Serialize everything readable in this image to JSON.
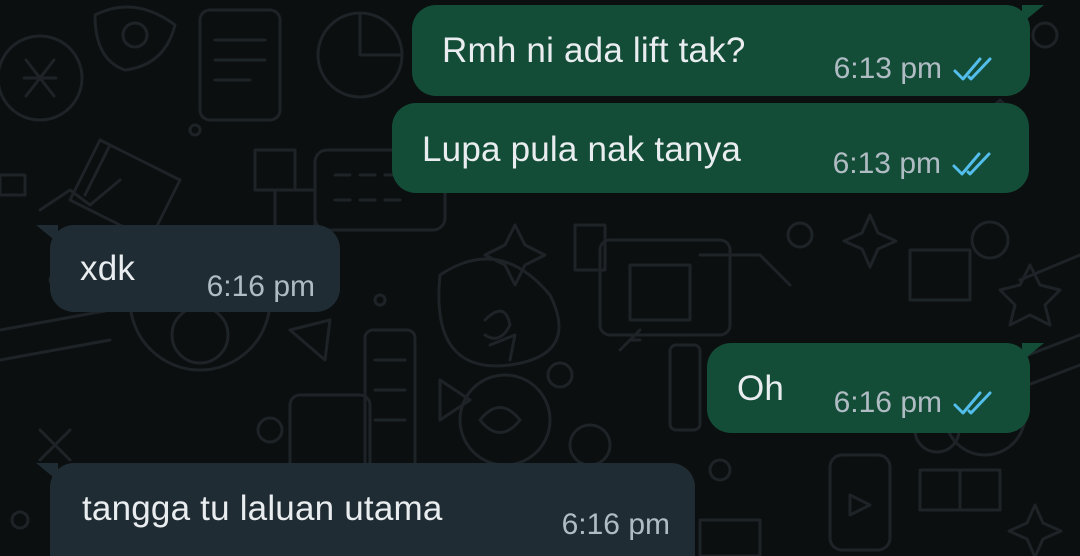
{
  "messages": [
    {
      "text": "Rmh ni ada lift tak?",
      "time": "6:13 pm",
      "status": "read-double-check-icon"
    },
    {
      "text": "Lupa pula nak tanya",
      "time": "6:13 pm",
      "status": "read-double-check-icon"
    },
    {
      "text": "xdk",
      "time": "6:16 pm"
    },
    {
      "text": "Oh",
      "time": "6:16 pm",
      "status": "read-double-check-icon"
    },
    {
      "text": "tangga tu laluan utama",
      "time": "6:16 pm"
    }
  ],
  "colors": {
    "background": "#0b0f10",
    "outgoing_bubble": "#144d37",
    "incoming_bubble": "#202c33",
    "text": "#e9edef",
    "timestamp": "#b0bcc3",
    "read_ticks": "#53bdeb"
  }
}
